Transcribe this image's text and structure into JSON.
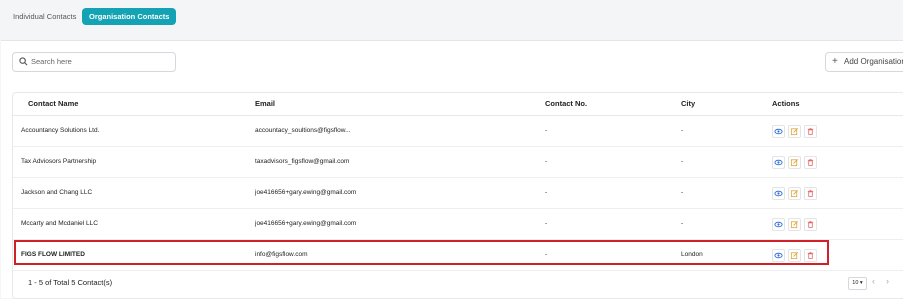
{
  "tabs": [
    {
      "label": "Individual Contacts",
      "active": false
    },
    {
      "label": "Organisation Contacts",
      "active": true
    }
  ],
  "search": {
    "placeholder": "Search here",
    "value": ""
  },
  "add_button": {
    "label": "Add Organisation"
  },
  "table": {
    "columns": [
      "Contact Name",
      "Email",
      "Contact No.",
      "City",
      "Actions"
    ],
    "rows": [
      {
        "name": "Accountancy Solutions Ltd.",
        "email": "accountacy_soultions@figsflow...",
        "phone": "-",
        "city": "-"
      },
      {
        "name": "Tax Adviosors Partnership",
        "email": "taxadvisors_figsflow@gmail.com",
        "phone": "-",
        "city": "-"
      },
      {
        "name": "Jackson and Chang LLC",
        "email": "joe416656+gary.ewing@gmail.com",
        "phone": "-",
        "city": "-"
      },
      {
        "name": "Mccarty and Mcdaniel LLC",
        "email": "joe416656+gary.ewing@gmail.com",
        "phone": "-",
        "city": "-"
      },
      {
        "name": "FIGS FLOW LIMITED",
        "email": "info@figsflow.com",
        "phone": "-",
        "city": "London"
      }
    ]
  },
  "footer": {
    "summary": "1 - 5 of Total 5 Contact(s)",
    "page_size": "10",
    "prev_icon": "chevron-left-icon",
    "next_icon": "chevron-right-icon"
  },
  "colors": {
    "accent": "#13a3b4",
    "view": "#2f6fd6",
    "edit": "#e0a33a",
    "delete": "#e46a6a",
    "highlight": "#d0202a"
  },
  "icons": {
    "search": "search-icon",
    "view": "eye-icon",
    "edit": "edit-icon",
    "delete": "trash-icon",
    "add": "plus-icon"
  }
}
